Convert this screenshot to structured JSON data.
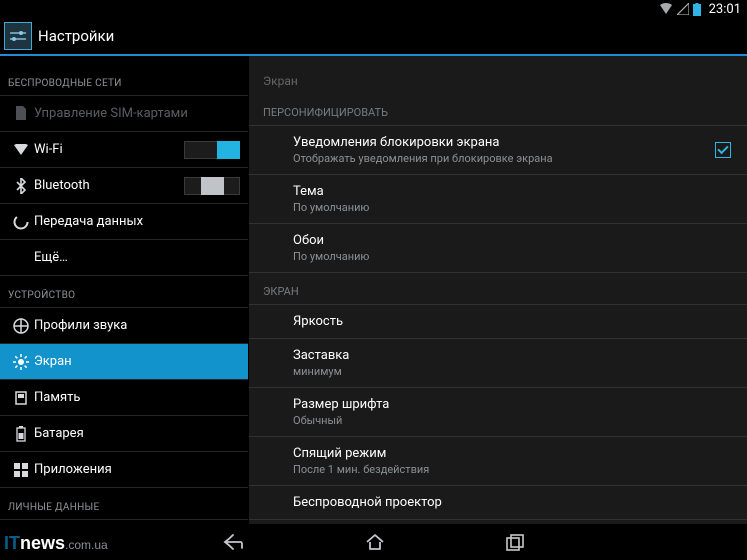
{
  "statusbar": {
    "time": "23:01"
  },
  "appbar": {
    "title": "Настройки"
  },
  "sidebar": {
    "section_wireless": "БЕСПРОВОДНЫЕ СЕТИ",
    "sim": "Управление SIM-картами",
    "wifi": "Wi-Fi",
    "bluetooth": "Bluetooth",
    "data": "Передача данных",
    "more": "Ещё…",
    "section_device": "УСТРОЙСТВО",
    "audio": "Профили звука",
    "display": "Экран",
    "memory": "Память",
    "battery": "Батарея",
    "apps": "Приложения",
    "section_personal": "ЛИЧНЫЕ ДАННЫЕ"
  },
  "detail": {
    "title": "Экран",
    "cat_personalize": "ПЕРСОНИФИЦИРОВАТЬ",
    "lock_notif_title": "Уведомления блокировки экрана",
    "lock_notif_sub": "Отображать уведомления при блокировке экрана",
    "theme_title": "Тема",
    "theme_sub": "По умолчанию",
    "wallpaper_title": "Обои",
    "wallpaper_sub": "По умолчанию",
    "cat_screen": "ЭКРАН",
    "brightness": "Яркость",
    "dream_title": "Заставка",
    "dream_sub": "минимум",
    "font_title": "Размер шрифта",
    "font_sub": "Обычный",
    "sleep_title": "Спящий режим",
    "sleep_sub": "После 1 мин. бездействия",
    "cast_title": "Беспроводной проектор"
  },
  "watermark": {
    "it": "IT",
    "news": "news",
    "domain": ".com.ua"
  }
}
